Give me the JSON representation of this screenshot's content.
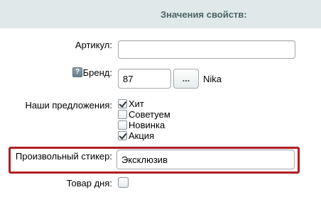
{
  "header": {
    "title": "Значения свойств:"
  },
  "fields": {
    "article": {
      "label": "Артикул:",
      "value": ""
    },
    "brand": {
      "help_icon": "question-icon",
      "help_glyph": "?",
      "label": "Бренд:",
      "value": "87",
      "button_label": "...",
      "brand_name": "Nika"
    },
    "offers": {
      "label": "Наши предложения:",
      "options": [
        {
          "label": "Хит",
          "checked": true
        },
        {
          "label": "Советуем",
          "checked": false
        },
        {
          "label": "Новинка",
          "checked": false
        },
        {
          "label": "Акция",
          "checked": true
        }
      ]
    },
    "sticker": {
      "label": "Произвольный стикер:",
      "value": "Эксклюзив",
      "highlight_color": "#b11e24"
    },
    "day_product": {
      "label": "Товар дня:",
      "checked": false
    }
  },
  "colors": {
    "header_bg": "#e0e8ea",
    "header_text": "#4b6267"
  }
}
